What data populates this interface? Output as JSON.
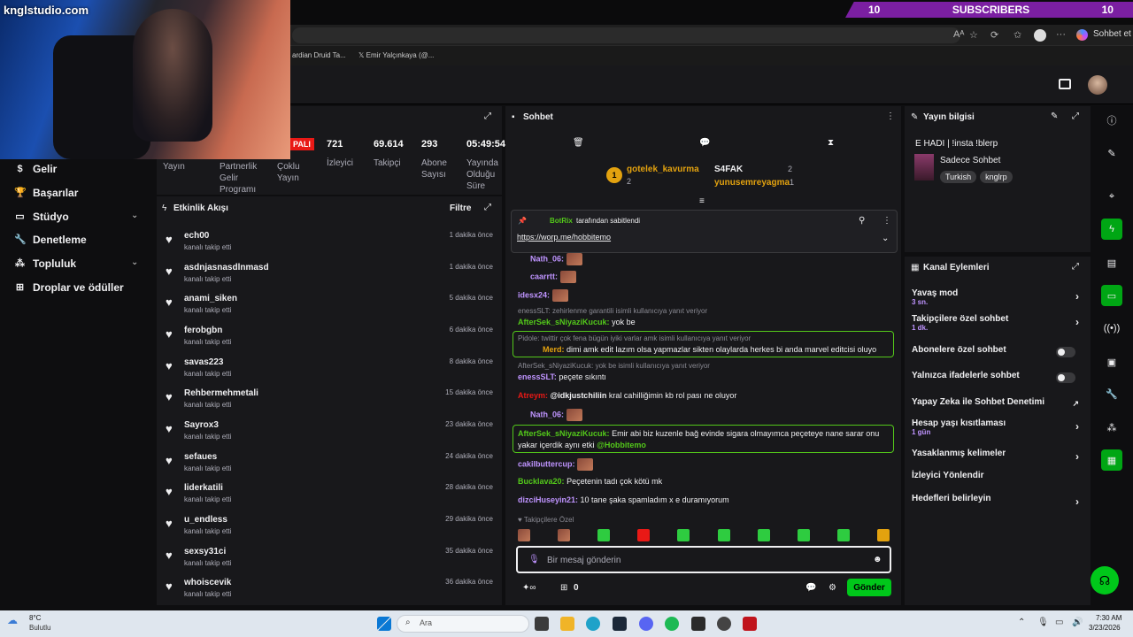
{
  "banner": {
    "left_count": "10",
    "label": "SUBSCRIBERS",
    "right_count": "10"
  },
  "overlay_logo": "knglstudio.com",
  "browser": {
    "bookmarks": [
      "ardian Druid Ta...",
      "Emir Yalçınkaya (@..."
    ],
    "sohbet_et": "Sohbet et"
  },
  "nav": {
    "items": [
      {
        "label": "Gelir",
        "icon": "dollar-icon"
      },
      {
        "label": "Başarılar",
        "icon": "trophy-icon"
      },
      {
        "label": "Stüdyo",
        "icon": "studio-icon"
      },
      {
        "label": "Denetleme",
        "icon": "wrench-icon"
      },
      {
        "label": "Topluluk",
        "icon": "community-icon"
      },
      {
        "label": "Droplar ve ödüller",
        "icon": "gift-icon"
      }
    ]
  },
  "stats": {
    "live_badge": "PALI",
    "yayin": "Yayın",
    "partner": "Partnerlik Gelir Programı",
    "coklu": "Çoklu Yayın",
    "izleyici_val": "721",
    "izleyici": "İzleyici",
    "takipci_val": "69.614",
    "takipci": "Takipçi",
    "abone_val": "293",
    "abone": "Abone Sayısı",
    "sure_val": "05:49:54",
    "sure": "Yayında Olduğu Süre"
  },
  "activity": {
    "title": "Etkinlik Akışı",
    "filter": "Filtre",
    "events": [
      {
        "name": "ech00",
        "sub": "kanalı takip etti",
        "time": "1 dakika önce"
      },
      {
        "name": "asdnjasnasdlnmasd",
        "sub": "kanalı takip etti",
        "time": "1 dakika önce"
      },
      {
        "name": "anami_siken",
        "sub": "kanalı takip etti",
        "time": "5 dakika önce"
      },
      {
        "name": "ferobgbn",
        "sub": "kanalı takip etti",
        "time": "6 dakika önce"
      },
      {
        "name": "savas223",
        "sub": "kanalı takip etti",
        "time": "8 dakika önce"
      },
      {
        "name": "Rehbermehmetali",
        "sub": "kanalı takip etti",
        "time": "15 dakika önce"
      },
      {
        "name": "Sayrox3",
        "sub": "kanalı takip etti",
        "time": "23 dakika önce"
      },
      {
        "name": "sefaues",
        "sub": "kanalı takip etti",
        "time": "24 dakika önce"
      },
      {
        "name": "liderkatili",
        "sub": "kanalı takip etti",
        "time": "28 dakika önce"
      },
      {
        "name": "u_endless",
        "sub": "kanalı takip etti",
        "time": "29 dakika önce"
      },
      {
        "name": "sexsy31ci",
        "sub": "kanalı takip etti",
        "time": "35 dakika önce"
      },
      {
        "name": "whoiscevik",
        "sub": "kanalı takip etti",
        "time": "36 dakika önce"
      }
    ]
  },
  "chat": {
    "title": "Sohbet",
    "leaders": [
      {
        "rank": "1",
        "name": "gotelek_kavurma",
        "count": "2"
      },
      {
        "name": "S4FAK",
        "count": "2"
      },
      {
        "name": "yunusemreyagma",
        "count": "1"
      }
    ],
    "pinned_by": "BotRix",
    "pinned_suffix": "tarafından sabitlendi",
    "pinned_link": "https://worp.me/hobbitemo",
    "messages": {
      "m1_user": "Nath_06:",
      "m2_user": "caarrtt:",
      "m3_user": "idesx24:",
      "m4_reply": "enessSLT: zehirlenme garantili isimli kullanıcıya yanıt veriyor",
      "m4_user": "AfterSek_sNiyaziKucuk:",
      "m4_text": "yok be",
      "m5_reply": "Pidole: twittir çok fena bügün iyiki varlar amk isimli kullanıcıya yanıt veriyor",
      "m5_user": "Merd:",
      "m5_text": "dimi amk edit lazım olsa yapmazlar sikten olaylarda herkes bi anda marvel editcisi oluyo",
      "m6_reply": "AfterSek_sNiyaziKucuk: yok be isimli kullanıcıya yanıt veriyor",
      "m6_user": "enessSLT:",
      "m6_text": "peçete sıkıntı",
      "m7_user": "Atreym:",
      "m7_mention": "@idkjustchiliin",
      "m7_text": "kral cahilliğimin kb rol pası ne oluyor",
      "m8_user": "Nath_06:",
      "m9_user": "AfterSek_sNiyaziKucuk:",
      "m9_text": "Emir abi biz kuzenle bağ evinde sigara olmayımca peçeteye nane sarar onu yakar içerdik aynı etki",
      "m9_mention": "@Hobbitemo",
      "m10_user": "cakilbuttercup:",
      "m11_user": "Bucklava20:",
      "m11_text": "Peçetenin tadı çok kötü mk",
      "m12_user": "dizciHuseyin21:",
      "m12_text": "10 tane şaka spamladım x e duramıyorum"
    },
    "followers_only": "Takipçilere Özel",
    "placeholder": "Bir mesaj gönderin",
    "points": "0",
    "send": "Gönder"
  },
  "info": {
    "title": "Yayın bilgisi",
    "stream_title": "E HADI | !insta !blerp",
    "category": "Sadece Sohbet",
    "tags": [
      "Turkish",
      "knglrp"
    ]
  },
  "actions": {
    "title": "Kanal Eylemleri",
    "items": [
      {
        "label": "Yavaş mod",
        "sub": "3 sn."
      },
      {
        "label": "Takipçilere özel sohbet",
        "sub": "1 dk."
      },
      {
        "label": "Abonelere özel sohbet"
      },
      {
        "label": "Yalnızca ifadelerle sohbet"
      },
      {
        "label": "Yapay Zeka ile Sohbet Denetimi"
      },
      {
        "label": "Hesap yaşı kısıtlaması",
        "sub": "1 gün"
      },
      {
        "label": "Yasaklanmış kelimeler"
      },
      {
        "label": "İzleyici Yönlendir"
      },
      {
        "label": "Hedefleri belirleyin"
      }
    ]
  },
  "taskbar": {
    "weather_temp": "8°C",
    "weather_text": "Bulutlu",
    "search": "Ara",
    "time": "7:30 AM",
    "date": "3/23/2026"
  }
}
